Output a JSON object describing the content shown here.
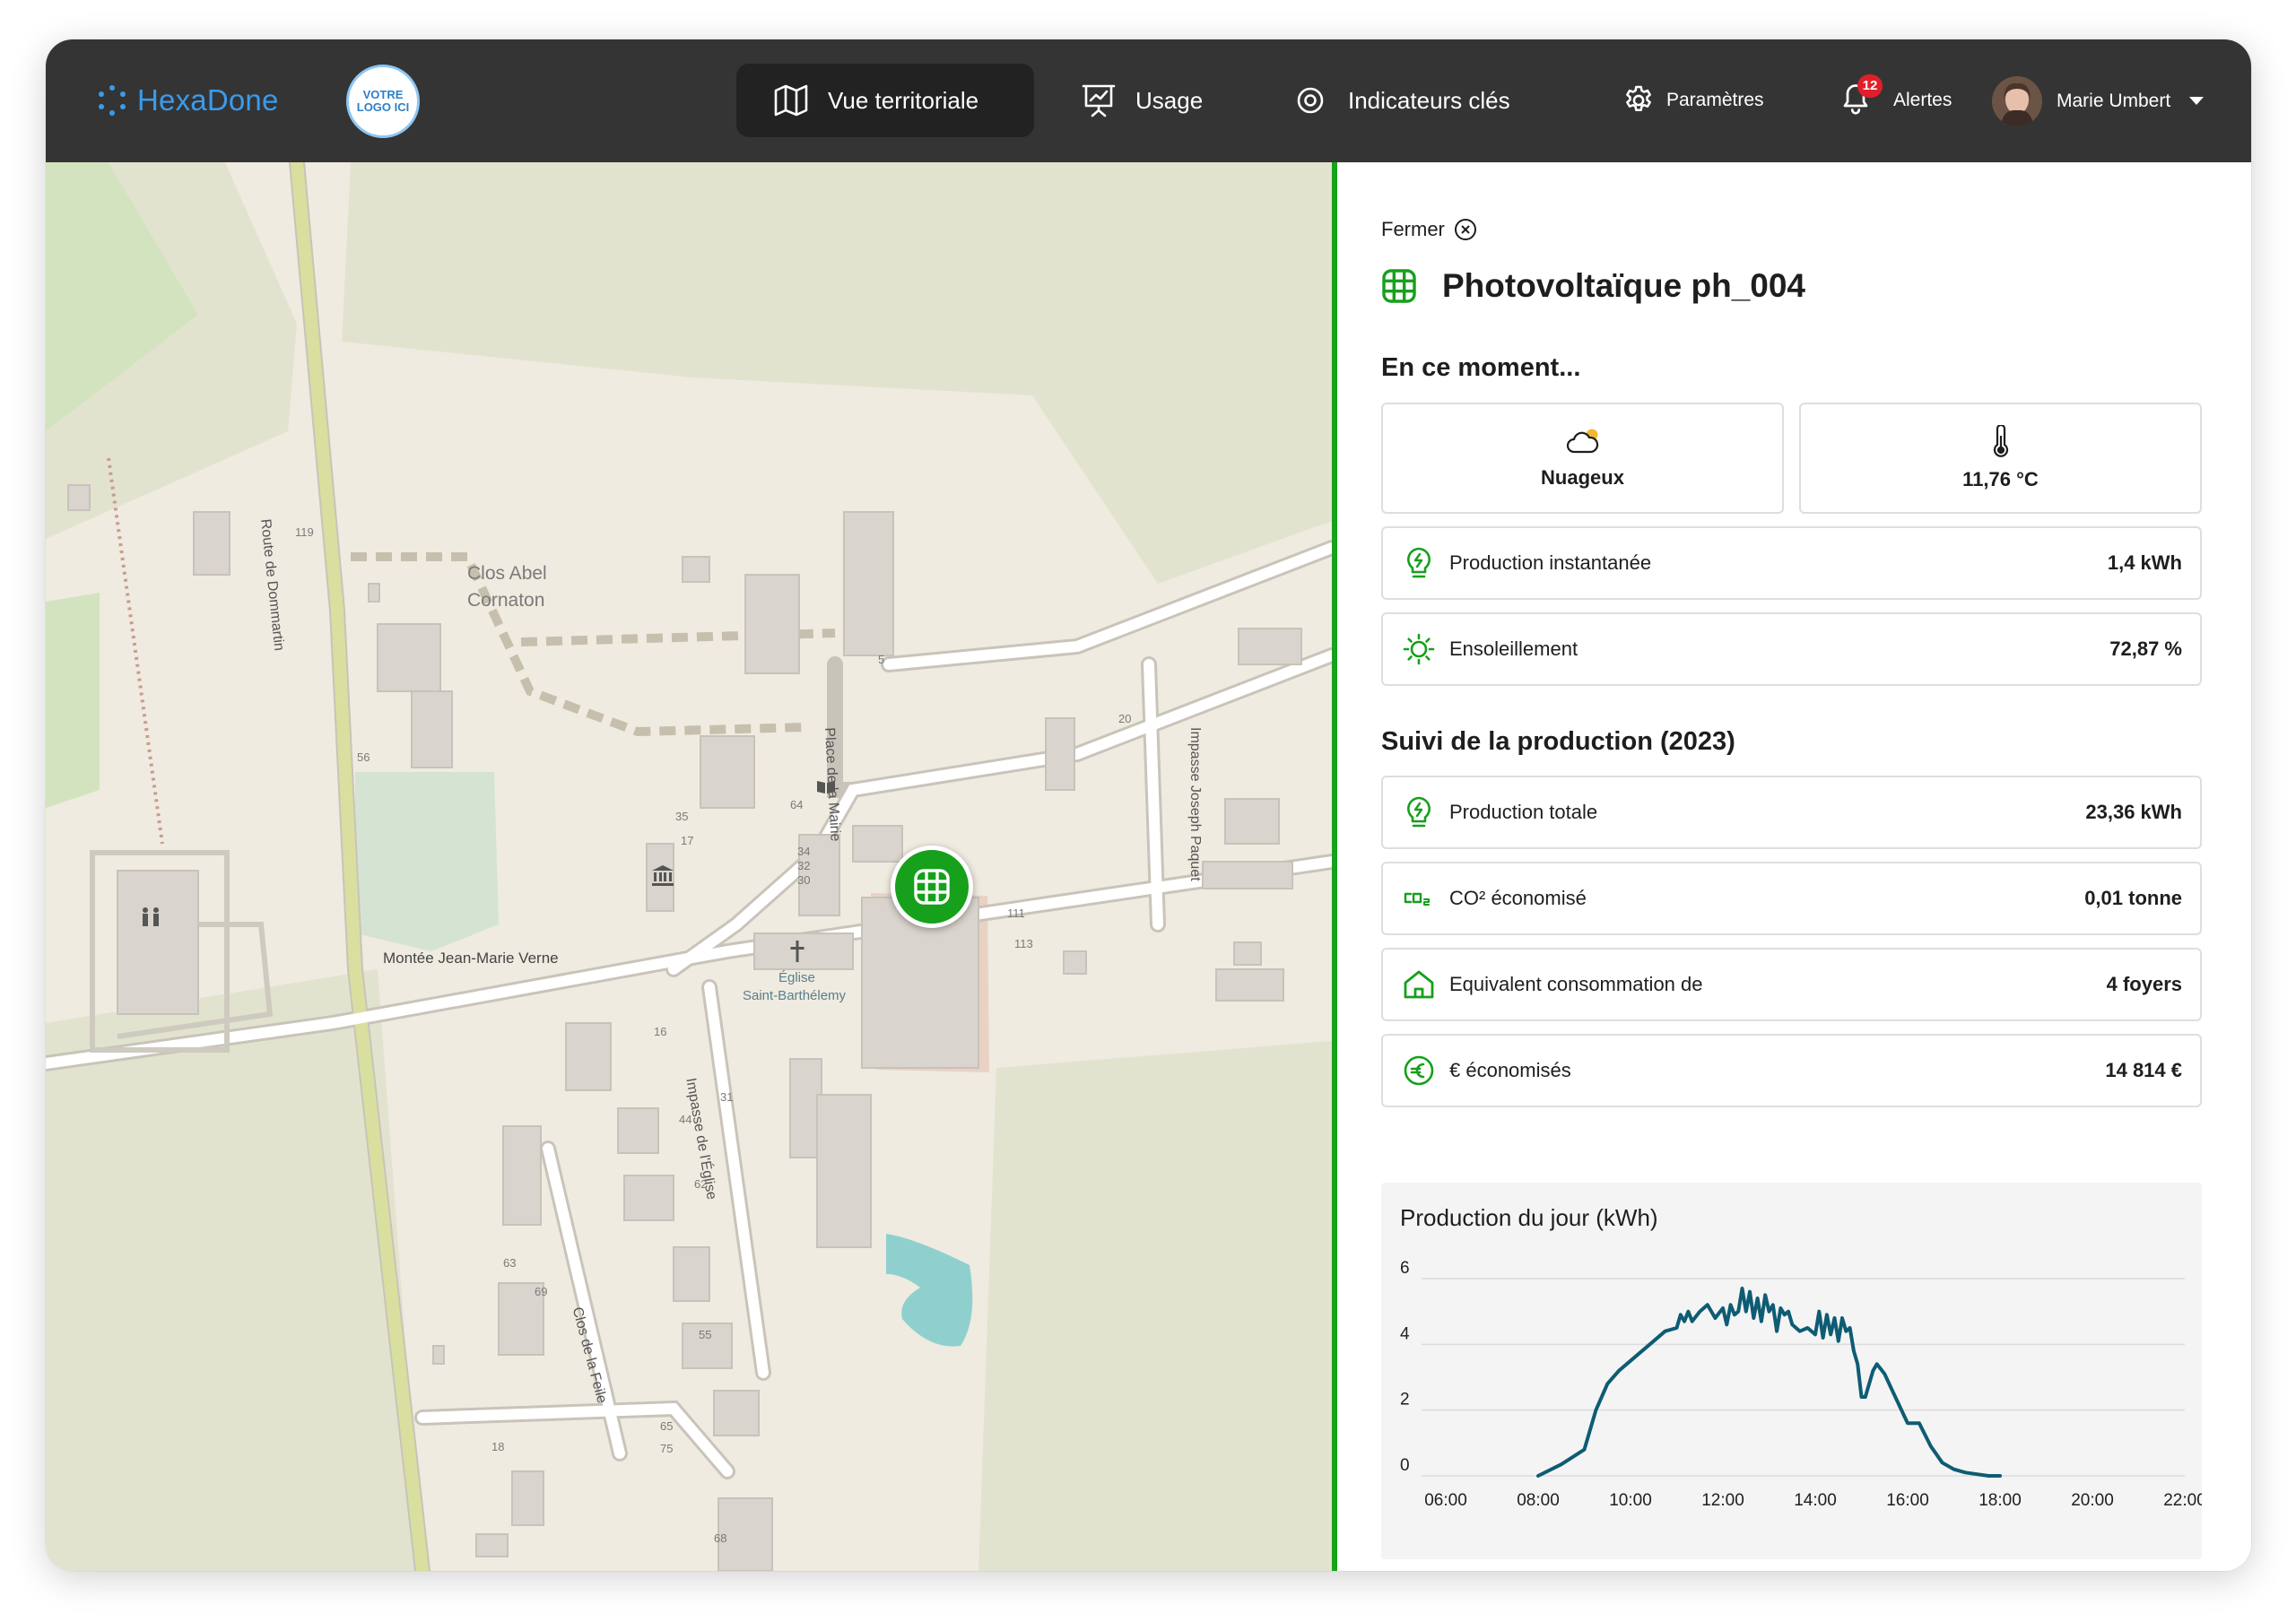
{
  "brand": {
    "name": "HexaDone",
    "client_logo_line1": "VOTRE",
    "client_logo_line2": "LOGO ICI"
  },
  "nav": {
    "items": [
      {
        "label": "Vue territoriale",
        "icon": "map-icon",
        "active": true
      },
      {
        "label": "Usage",
        "icon": "presentation-chart-icon",
        "active": false
      },
      {
        "label": "Indicateurs clés",
        "icon": "eye-icon",
        "active": false
      }
    ],
    "settings_label": "Paramètres",
    "alerts_label": "Alertes",
    "alerts_count": "12",
    "user_name": "Marie Umbert"
  },
  "map": {
    "labels": {
      "route_dommartin": "Route de Dommartin",
      "clos_abel_1": "Clos Abel",
      "clos_abel_2": "Cornaton",
      "place_mairie": "Place de la Mairie",
      "impasse_paquet": "Impasse Joseph Paquet",
      "montee": "Montée Jean-Marie Verne",
      "eglise_1": "Église",
      "eglise_2": "Saint-Barthélemy",
      "impasse_eglise": "Impasse de l'Église",
      "clos_feile": "Clos de la Feile"
    },
    "numbers": [
      "119",
      "5",
      "20",
      "56",
      "35",
      "17",
      "64",
      "34",
      "32",
      "30",
      "111",
      "113",
      "16",
      "31",
      "44",
      "62",
      "63",
      "69",
      "55",
      "65",
      "75",
      "18",
      "68"
    ]
  },
  "panel": {
    "close_label": "Fermer",
    "title": "Photovoltaïque ph_004",
    "now_heading": "En ce moment...",
    "weather": {
      "condition": "Nuageux",
      "temperature": "11,76 °C"
    },
    "now_rows": [
      {
        "label": "Production instantanée",
        "value": "1,4 kWh",
        "icon": "lightbulb-bolt-icon"
      },
      {
        "label": "Ensoleillement",
        "value": "72,87 %",
        "icon": "sun-icon"
      }
    ],
    "tracking_heading": "Suivi de la production (2023)",
    "tracking_rows": [
      {
        "label": "Production totale",
        "value": "23,36 kWh",
        "icon": "lightbulb-bolt-icon"
      },
      {
        "label": "CO² économisé",
        "value": "0,01 tonne",
        "icon": "co2-icon"
      },
      {
        "label": "Equivalent consommation de",
        "value": "4 foyers",
        "icon": "house-icon"
      },
      {
        "label": "€ économisés",
        "value": "14 814 €",
        "icon": "euro-icon"
      }
    ]
  },
  "chart_data": {
    "type": "line",
    "title": "Production du jour (kWh)",
    "xlabel": "",
    "ylabel": "",
    "ylim": [
      0,
      6
    ],
    "yticks": [
      0,
      2,
      4,
      6
    ],
    "xlim": [
      "06:00",
      "22:00"
    ],
    "xticks": [
      "06:00",
      "08:00",
      "10:00",
      "12:00",
      "14:00",
      "16:00",
      "18:00",
      "20:00",
      "22:00"
    ],
    "grid": true,
    "color": "#0e5c73",
    "series": [
      {
        "x": [
          "08:00",
          "08:30",
          "09:00",
          "09:15",
          "09:30",
          "09:45",
          "10:00",
          "10:15",
          "10:30",
          "10:45",
          "11:00",
          "11:05",
          "11:10",
          "11:15",
          "11:20",
          "11:30",
          "11:40",
          "11:50",
          "12:00",
          "12:05",
          "12:10",
          "12:15",
          "12:20",
          "12:25",
          "12:30",
          "12:35",
          "12:40",
          "12:45",
          "12:50",
          "12:55",
          "13:00",
          "13:05",
          "13:10",
          "13:15",
          "13:20",
          "13:25",
          "13:30",
          "13:40",
          "13:50",
          "14:00",
          "14:05",
          "14:10",
          "14:15",
          "14:20",
          "14:25",
          "14:30",
          "14:35",
          "14:40",
          "14:45",
          "14:50",
          "14:55",
          "15:00",
          "15:05",
          "15:15",
          "15:20",
          "15:30",
          "15:40",
          "15:50",
          "16:00",
          "16:15",
          "16:30",
          "16:45",
          "17:00",
          "17:15",
          "17:30",
          "17:45",
          "18:00"
        ],
        "values": [
          0,
          0.35,
          0.8,
          2.0,
          2.8,
          3.2,
          3.5,
          3.8,
          4.1,
          4.4,
          4.5,
          4.9,
          4.7,
          5.0,
          4.7,
          5.0,
          5.2,
          4.8,
          5.1,
          4.6,
          5.2,
          4.9,
          5.0,
          5.7,
          5.0,
          5.6,
          4.8,
          5.4,
          4.7,
          5.5,
          5.0,
          5.2,
          4.4,
          5.1,
          4.9,
          5.0,
          4.6,
          4.4,
          4.5,
          4.3,
          5.0,
          4.2,
          4.9,
          4.3,
          4.8,
          4.1,
          4.8,
          4.4,
          4.5,
          3.8,
          3.4,
          2.4,
          2.4,
          3.2,
          3.4,
          3.1,
          2.6,
          2.1,
          1.6,
          1.6,
          0.9,
          0.4,
          0.2,
          0.1,
          0.05,
          0,
          0
        ]
      }
    ]
  }
}
